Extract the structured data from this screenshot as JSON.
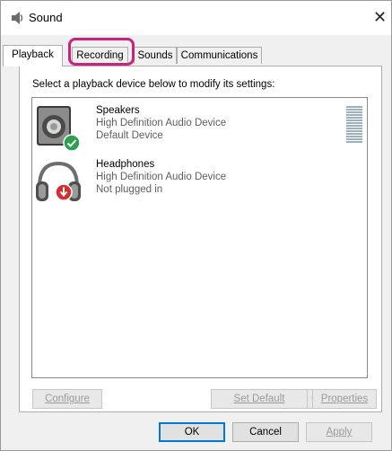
{
  "window": {
    "title": "Sound",
    "close_glyph": "✕"
  },
  "tabs": [
    {
      "label": "Playback",
      "active": true
    },
    {
      "label": "Recording",
      "active": false,
      "highlighted": true
    },
    {
      "label": "Sounds",
      "active": false
    },
    {
      "label": "Communications",
      "active": false
    }
  ],
  "panel": {
    "instruction": "Select a playback device below to modify its settings:",
    "devices": [
      {
        "name": "Speakers",
        "driver": "High Definition Audio Device",
        "status": "Default Device",
        "icon": "speaker-icon",
        "badge": "check-badge-icon"
      },
      {
        "name": "Headphones",
        "driver": "High Definition Audio Device",
        "status": "Not plugged in",
        "icon": "headphones-icon",
        "badge": "down-arrow-badge-icon"
      }
    ],
    "configure_label": "Configure",
    "set_default_label": "Set Default",
    "properties_label": "Properties"
  },
  "footer": {
    "ok_label": "OK",
    "cancel_label": "Cancel",
    "apply_label": "Apply"
  },
  "colors": {
    "highlight": "#c8237d",
    "check_badge": "#2e9e4f",
    "unplugged_badge": "#d32f2f",
    "level_meter": "#9bb1bf"
  }
}
